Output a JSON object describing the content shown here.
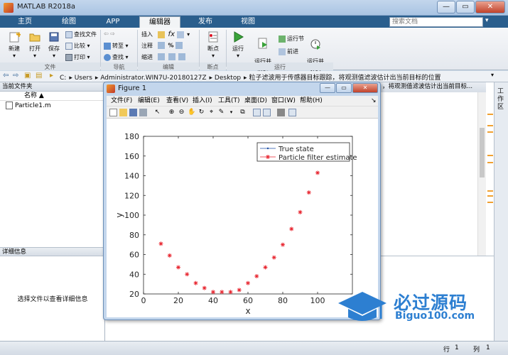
{
  "window": {
    "title": "MATLAB R2018a"
  },
  "tabs": [
    {
      "label": "主页"
    },
    {
      "label": "绘图"
    },
    {
      "label": "APP"
    },
    {
      "label": "编辑器"
    },
    {
      "label": "发布"
    },
    {
      "label": "视图"
    }
  ],
  "search": {
    "placeholder": "搜索文档"
  },
  "ribbon": {
    "new_label": "新建",
    "open_label": "打开",
    "save_label": "保存",
    "find_files_label": "查找文件",
    "compare_label": "比较",
    "print_label": "打印",
    "goto_label": "转至",
    "find_label": "查找",
    "insert_label": "插入",
    "comment_label": "注释",
    "indent_label": "缩进",
    "breakpoints_label": "断点",
    "run_label": "运行",
    "run_advance_label": "运行并\n前进",
    "run_section_label": "运行节",
    "advance_label": "前进",
    "run_time_label": "运行并\n计时",
    "group_file": "文件",
    "group_nav": "导航",
    "group_edit": "编辑",
    "group_break": "断点",
    "group_run": "运行"
  },
  "address": {
    "segments": [
      "C:",
      "Users",
      "Administrator.WIN7U-20180127Z",
      "Desktop",
      "粒子滤波用于传感器目标跟踪，将观测值滤波估计出当前目标的位置"
    ]
  },
  "current_folder": {
    "header": "当前文件夹",
    "col_name": "名称 ▲",
    "files": [
      "Particle1.m"
    ]
  },
  "details": {
    "header": "详细信息",
    "message": "选择文件以查看详细信息"
  },
  "command": {
    "header_text": "，将观测值滤波估计出当前目标..."
  },
  "side_toolbar": {
    "label": "工作区"
  },
  "status": {
    "row_label": "行",
    "row_value": "1",
    "col_label": "列",
    "col_value": "1"
  },
  "figure": {
    "title": "Figure 1",
    "menu": [
      "文件(F)",
      "编辑(E)",
      "查看(V)",
      "插入(I)",
      "工具(T)",
      "桌面(D)",
      "窗口(W)",
      "帮助(H)"
    ]
  },
  "chart_data": {
    "type": "line",
    "xlabel": "x",
    "ylabel": "y",
    "xlim": [
      0,
      120
    ],
    "ylim": [
      20,
      180
    ],
    "xticks": [
      0,
      20,
      40,
      60,
      80,
      100
    ],
    "yticks": [
      20,
      40,
      60,
      80,
      100,
      120,
      140,
      160,
      180
    ],
    "legend_position": "top-right",
    "series": [
      {
        "name": "True state",
        "color": "#1f4fa6",
        "marker": "dot",
        "x": [
          10,
          15,
          20,
          25,
          30,
          35,
          40,
          45,
          50,
          55,
          60,
          65,
          70,
          75,
          80,
          85,
          90,
          95,
          100
        ],
        "y": [
          71,
          59,
          47,
          40,
          31,
          26,
          22,
          22,
          22,
          24,
          31,
          38,
          47,
          57,
          70,
          86,
          103,
          123,
          143
        ]
      },
      {
        "name": "Particle filter estimate",
        "color": "#e8212b",
        "marker": "star",
        "x": [
          10,
          15,
          20,
          25,
          30,
          35,
          40,
          45,
          50,
          55,
          60,
          65,
          70,
          75,
          80,
          85,
          90,
          95,
          100
        ],
        "y": [
          71,
          59,
          47,
          40,
          31,
          26,
          22,
          22,
          22,
          24,
          31,
          38,
          47,
          57,
          70,
          86,
          103,
          123,
          143
        ]
      }
    ]
  },
  "watermark": {
    "text_zh": "必过源码",
    "text_url": "Biguo100.com"
  },
  "colors": {
    "tab_bar": "#2a5e8d",
    "accent": "#2d7fd1"
  }
}
